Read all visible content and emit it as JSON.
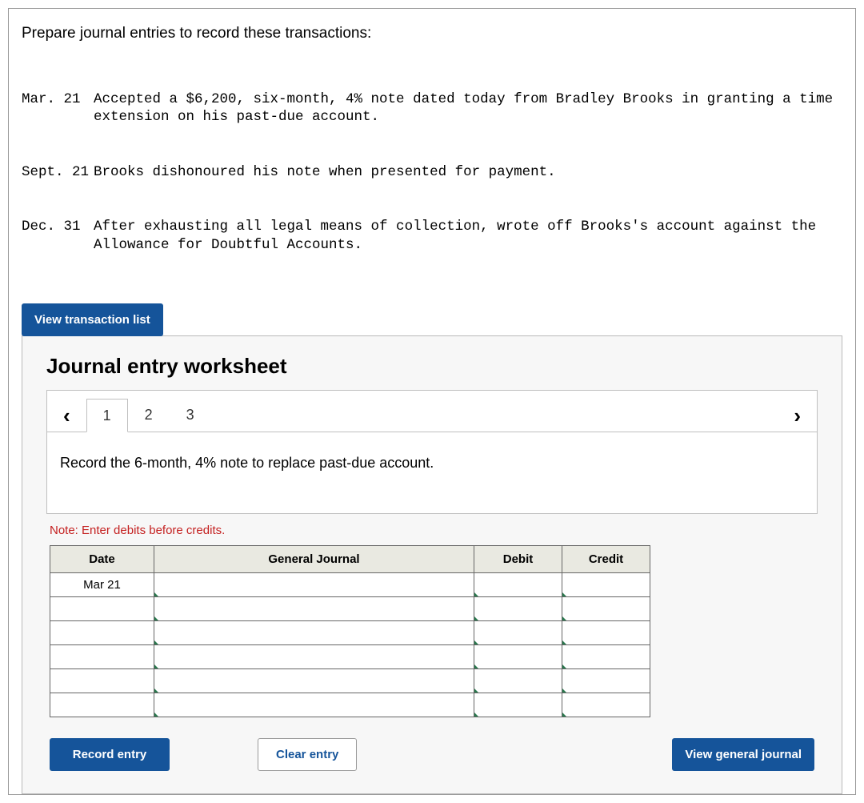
{
  "prompt": "Prepare journal entries to record these transactions:",
  "transactions": [
    {
      "date": "Mar. 21",
      "text": "Accepted a $6,200, six-month, 4% note dated today from Bradley Brooks in granting a time extension on his past-due account."
    },
    {
      "date": "Sept. 21",
      "text": "Brooks dishonoured his note when presented for payment."
    },
    {
      "date": "Dec. 31",
      "text": "After exhausting all legal means of collection, wrote off Brooks's account against the Allowance for Doubtful Accounts."
    }
  ],
  "buttons": {
    "view_trans_list": "View transaction list",
    "record_entry": "Record entry",
    "clear_entry": "Clear entry",
    "view_general_journal": "View general journal"
  },
  "worksheet": {
    "title": "Journal entry worksheet",
    "tabs": [
      "1",
      "2",
      "3"
    ],
    "active_tab": 0,
    "instruction": "Record the 6-month, 4% note to replace past-due account.",
    "note": "Note: Enter debits before credits.",
    "headers": {
      "date": "Date",
      "gj": "General Journal",
      "debit": "Debit",
      "credit": "Credit"
    },
    "rows": [
      {
        "date": "Mar 21",
        "gj": "",
        "debit": "",
        "credit": ""
      },
      {
        "date": "",
        "gj": "",
        "debit": "",
        "credit": ""
      },
      {
        "date": "",
        "gj": "",
        "debit": "",
        "credit": ""
      },
      {
        "date": "",
        "gj": "",
        "debit": "",
        "credit": ""
      },
      {
        "date": "",
        "gj": "",
        "debit": "",
        "credit": ""
      },
      {
        "date": "",
        "gj": "",
        "debit": "",
        "credit": ""
      }
    ]
  }
}
